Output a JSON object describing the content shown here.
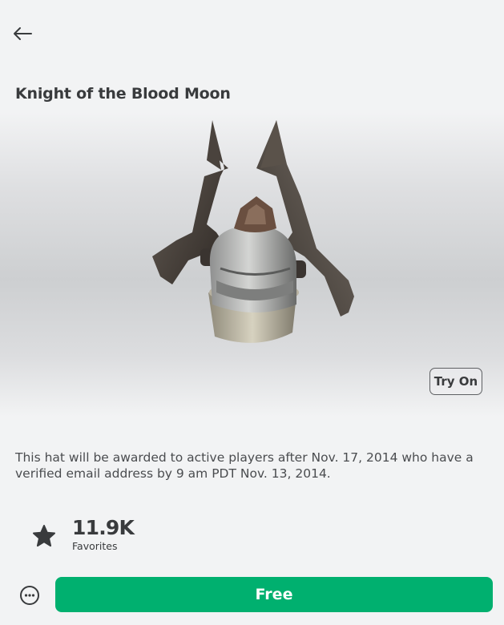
{
  "header": {
    "back_icon": "arrow-left-icon"
  },
  "item": {
    "title": "Knight of the Blood Moon",
    "description": "This hat will be awarded to active players after Nov. 17, 2014 who have a verified email address by 9 am PDT Nov. 13, 2014.",
    "image_icon": "knight-helmet-image"
  },
  "preview": {
    "try_on_label": "Try On"
  },
  "favorites": {
    "count": "11.9K",
    "label": "Favorites",
    "icon": "star-icon"
  },
  "footer": {
    "more_icon": "more-options-icon",
    "buy_label": "Free",
    "buy_color": "#00b06f"
  }
}
